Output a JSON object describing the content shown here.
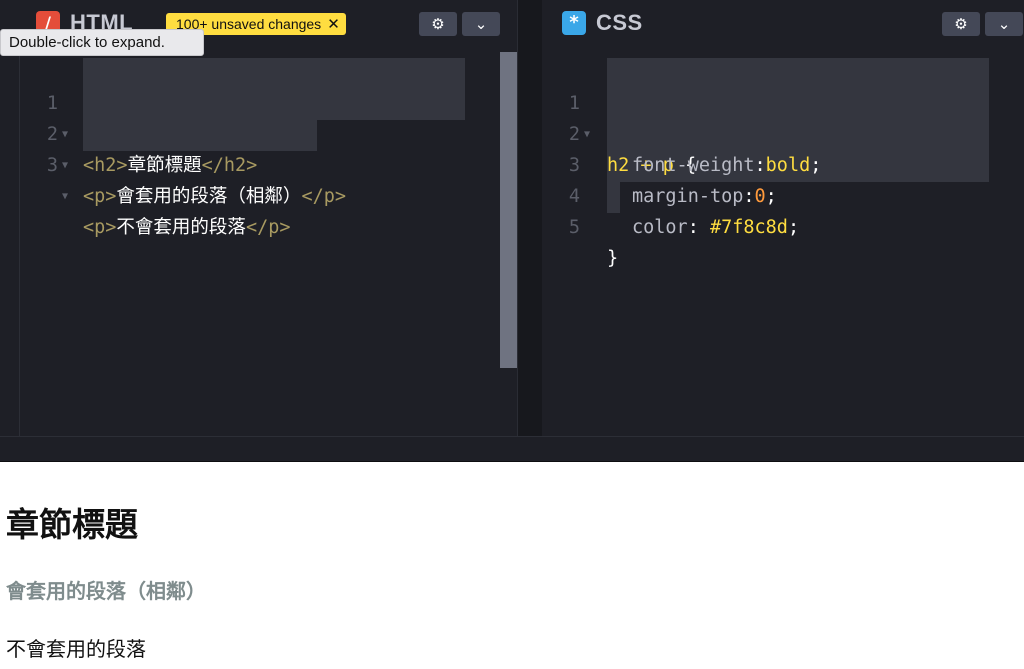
{
  "html_pane": {
    "title": "HTML",
    "badge": "100+ unsaved changes",
    "tooltip": "Double-click to expand.",
    "lines": [
      {
        "num": "1",
        "open": "<h2>",
        "text": "章節標題",
        "close": "</h2>"
      },
      {
        "num": "2",
        "open": "<p>",
        "text": "會套用的段落（相鄰）",
        "close": "</p>"
      },
      {
        "num": "3",
        "open": "<p>",
        "text": "不會套用的段落",
        "close": "</p>"
      }
    ]
  },
  "css_pane": {
    "title": "CSS",
    "icon_glyph": "*",
    "lines": [
      {
        "num": "1",
        "selector": "h2 + p",
        "brace": " {"
      },
      {
        "num": "2",
        "prop": "font-weight",
        "sep": ":",
        "value": "bold",
        "end": ";"
      },
      {
        "num": "3",
        "prop": "margin-top",
        "sep": ":",
        "value": "0",
        "end": ";"
      },
      {
        "num": "4",
        "prop": "color",
        "sep": ": ",
        "value": "#7f8c8d",
        "end": ";"
      },
      {
        "num": "5",
        "close": "}"
      }
    ]
  },
  "icons": {
    "settings": "gear-icon",
    "collapse": "chevron-down-icon",
    "close": "close-icon"
  },
  "preview": {
    "h2": "章節標題",
    "p1": "會套用的段落（相鄰）",
    "p2": "不會套用的段落"
  },
  "colors": {
    "editor_bg": "#1e1f26",
    "badge_bg": "#ffdd40",
    "html_icon": "#e44d3a",
    "css_icon": "#3aa7e8",
    "adjacent_text": "#7f8c8d"
  }
}
